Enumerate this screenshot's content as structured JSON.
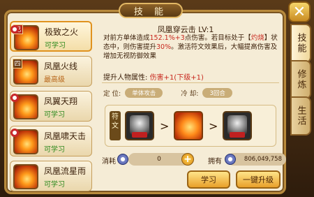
{
  "window": {
    "title": "技  能",
    "close_icon": "close-icon"
  },
  "skills": [
    {
      "name": "极致之火",
      "status": "可学习",
      "tag": "已",
      "selected": true
    },
    {
      "name": "凤凰火线",
      "status": "最高级",
      "tag": "四"
    },
    {
      "name": "凤翼天翔",
      "status": "可学习",
      "tag": ""
    },
    {
      "name": "凤凰啸天击",
      "status": "可学习",
      "tag": ""
    },
    {
      "name": "凤凰流星雨",
      "status": "可学习",
      "tag": ""
    }
  ],
  "side_tabs": [
    "技能",
    "修炼",
    "生活"
  ],
  "detail": {
    "title": "凤凰穿云击 LV:1",
    "desc_1": "对前方单体造成",
    "desc_red_1": "152.1%+3",
    "desc_2": "点伤害。若目标处于【",
    "desc_red_2": "灼烧",
    "desc_3": "】状态中，则伤害提升",
    "desc_red_3": "30%",
    "desc_4": "。激活符文效果后，大幅提高伤害及增加无视防御效果",
    "attr_label": "提升人物属性:",
    "attr_value": "伤害+1(下级+1)",
    "position_label": "定 位:",
    "position_value": "单体攻击",
    "cooldown_label": "冷 却:",
    "cooldown_value": "3回合",
    "rune_label": "符文",
    "cost_label": "消耗",
    "cost_value": "0",
    "own_label": "拥有",
    "own_value": "806,049,758",
    "learn_button": "学习",
    "upgrade_all_button": "一键升级"
  },
  "colors": {
    "accent": "#e9a02a",
    "highlight": "#c8281e",
    "available": "#2e8a1e"
  }
}
